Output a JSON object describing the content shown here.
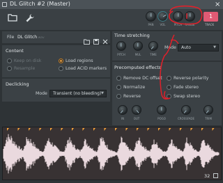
{
  "window": {
    "title": "DL Glitch #2 (Master)",
    "close_glyph": "×"
  },
  "header": {
    "knobs": [
      {
        "label": "PAN",
        "level": 0.5
      },
      {
        "label": "VOL",
        "level": 0.75
      },
      {
        "label": "PITCH",
        "level": 0.5
      },
      {
        "label": "RANGE",
        "level": 0.5
      }
    ],
    "track_button": {
      "label": "1",
      "caption": "TRACK"
    },
    "icons": [
      "folder-icon",
      "wrench-icon"
    ]
  },
  "file": {
    "label": "File",
    "name": "DL Glitch",
    "ext": ".wav",
    "icons": [
      "folder-icon",
      "save-icon",
      "close-icon"
    ]
  },
  "content": {
    "title": "Content",
    "options": [
      {
        "label": "Keep on disk",
        "checked": false,
        "enabled": false
      },
      {
        "label": "Load regions",
        "checked": true,
        "enabled": true
      },
      {
        "label": "Resample",
        "checked": false,
        "enabled": false
      },
      {
        "label": "Load ACID markers",
        "checked": false,
        "enabled": true
      }
    ]
  },
  "declicking": {
    "title": "Declicking",
    "mode_label": "Mode",
    "mode_value": "Transient (no bleeding)"
  },
  "time_stretching": {
    "title": "Time stretching",
    "knobs": [
      "PITCH",
      "MUL",
      "TIME"
    ],
    "mode_label": "Mode",
    "mode_value": "Auto"
  },
  "precomputed": {
    "title": "Precomputed effects",
    "effects": [
      {
        "label": "Remove DC offset",
        "checked": false
      },
      {
        "label": "Reverse polarity",
        "checked": false
      },
      {
        "label": "Normalize",
        "checked": false
      },
      {
        "label": "Fade stereo",
        "checked": false
      },
      {
        "label": "Reverse",
        "checked": false
      },
      {
        "label": "Swap stereo",
        "checked": false
      }
    ],
    "knobs": [
      "IN",
      "OUT",
      "POGO",
      "CROSSFADE",
      "TRIM"
    ]
  },
  "waveform": {
    "zoom": "32",
    "color": "#ead9de",
    "background": "#383233"
  },
  "colors": {
    "accent": "#f4a23a",
    "track": "#e05a74",
    "annotation": "#e0202a"
  }
}
